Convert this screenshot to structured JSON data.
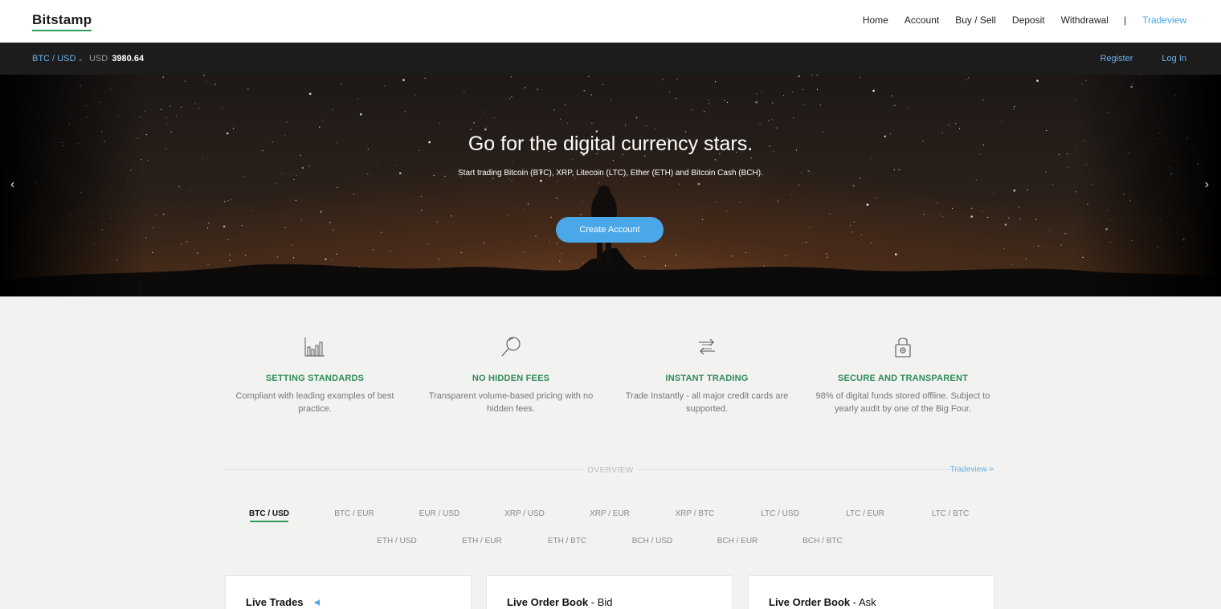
{
  "header": {
    "logo": "Bitstamp",
    "nav": [
      {
        "label": "Home"
      },
      {
        "label": "Account"
      },
      {
        "label": "Buy / Sell"
      },
      {
        "label": "Deposit"
      },
      {
        "label": "Withdrawal"
      }
    ],
    "separator": "|",
    "tradeview": "Tradeview"
  },
  "pricebar": {
    "pair": "BTC / USD",
    "currency": "USD",
    "price": "3980.64",
    "register": "Register",
    "login": "Log In"
  },
  "hero": {
    "title": "Go for the digital currency stars.",
    "subtitle": "Start trading Bitcoin (BTC), XRP, Litecoin (LTC), Ether (ETH) and Bitcoin Cash (BCH).",
    "cta": "Create Account",
    "prev": "‹",
    "next": "›"
  },
  "features": [
    {
      "icon": "bar-chart-icon",
      "title": "SETTING STANDARDS",
      "text": "Compliant with leading examples of best practice."
    },
    {
      "icon": "magnifier-icon",
      "title": "NO HIDDEN FEES",
      "text": "Transparent volume-based pricing with no hidden fees."
    },
    {
      "icon": "exchange-arrows-icon",
      "title": "INSTANT TRADING",
      "text": "Trade Instantly - all major credit cards are supported."
    },
    {
      "icon": "padlock-icon",
      "title": "SECURE AND TRANSPARENT",
      "text": "98% of digital funds stored offline. Subject to yearly audit by one of the Big Four."
    }
  ],
  "overview": {
    "label": "OVERVIEW",
    "link": "Tradeview >",
    "pairs_row1": [
      "BTC / USD",
      "BTC / EUR",
      "EUR / USD",
      "XRP / USD",
      "XRP / EUR",
      "XRP / BTC",
      "LTC / USD",
      "LTC / EUR",
      "LTC / BTC"
    ],
    "pairs_row2": [
      "ETH / USD",
      "ETH / EUR",
      "ETH / BTC",
      "BCH / USD",
      "BCH / EUR",
      "BCH / BTC"
    ],
    "active_pair": "BTC / USD"
  },
  "cards": [
    {
      "title": "Live Trades",
      "suffix": ""
    },
    {
      "title": "Live Order Book",
      "suffix": " - Bid"
    },
    {
      "title": "Live Order Book",
      "suffix": " - Ask"
    }
  ],
  "colors": {
    "accent": "#4aa7e8",
    "brand_green": "#2e9b58",
    "feature_green": "#2e8a58",
    "dark_bar": "#1c1c1c"
  }
}
